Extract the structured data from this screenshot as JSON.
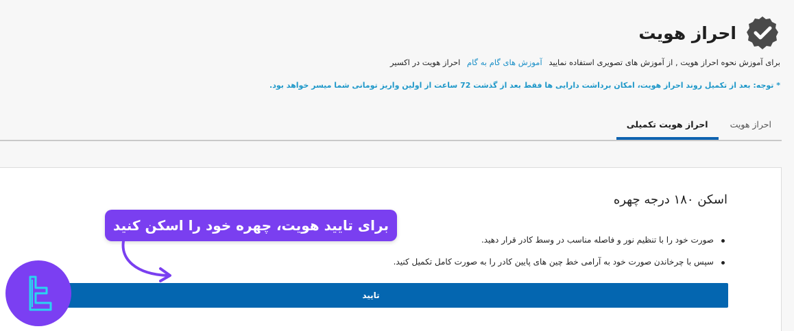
{
  "page": {
    "title": "احراز هویت",
    "intro_text": "برای آموزش نحوه احراز هویت , از آموزش های تصویری استفاده نمایید",
    "intro_link": "آموزش های گام به گام",
    "intro_suffix": "احراز هویت در اکسیر",
    "note": "* توجه: بعد از تکمیل روند احراز هویت، امکان برداشت دارایی ها فقط بعد از گذشت 72 ساعت از اولین واریز تومانی شما میسر خواهد بود."
  },
  "tabs": [
    {
      "label": "احراز هویت",
      "active": false
    },
    {
      "label": "احراز هویت تکمیلی",
      "active": true
    }
  ],
  "card": {
    "title": "اسکن ۱۸۰ درجه چهره",
    "bullets": [
      "صورت خود را با تنظیم نور و فاصله مناسب در وسط کادر قرار دهید.",
      "سپس با چرخاندن صورت خود به آرامی خط چین های پایین کادر را به صورت کامل تکمیل کنید."
    ],
    "confirm_label": "تایید"
  },
  "overlay": {
    "callout": "برای تایید هویت، چهره خود را اسکن کنید"
  },
  "colors": {
    "accent_blue": "#0466b0",
    "link_blue": "#1a8fc7",
    "callout_purple": "#7a3ff0"
  },
  "icons": {
    "badge": "check-badge-icon",
    "arrow": "curved-arrow-icon",
    "logo": "brand-logo-icon"
  }
}
